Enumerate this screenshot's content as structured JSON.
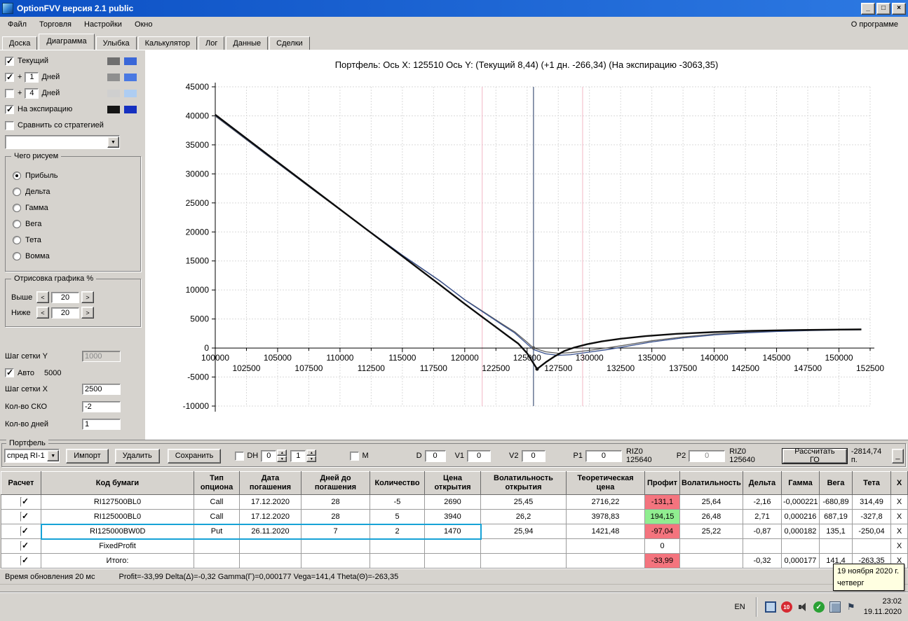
{
  "window": {
    "title": "OptionFVV версия 2.1 public",
    "controls": {
      "minimize": "_",
      "maximize": "□",
      "close": "×"
    }
  },
  "menu": {
    "items": [
      "Файл",
      "Торговля",
      "Настройки",
      "Окно"
    ],
    "about": "О программе"
  },
  "tabs": {
    "items": [
      "Доска",
      "Диаграмма",
      "Улыбка",
      "Калькулятор",
      "Лог",
      "Данные",
      "Сделки"
    ],
    "active": "Диаграмма"
  },
  "left_panel": {
    "current": {
      "checked": true,
      "label": "Текущий",
      "sw1": "#6f6f6f",
      "sw2": "#3a67d8"
    },
    "plus1": {
      "checked": true,
      "plus": "+",
      "value": "1",
      "label": "Дней",
      "sw1": "#8f8f8f",
      "sw2": "#4a79e2"
    },
    "plus4": {
      "checked": false,
      "plus": "+",
      "value": "4",
      "label": "Дней",
      "sw1": "#cfcfcf",
      "sw2": "#aecdf2"
    },
    "expiration": {
      "checked": true,
      "label": "На экспирацию",
      "sw1": "#151515",
      "sw2": "#1530c0"
    },
    "compare": {
      "checked": false,
      "label": "Сравнить со стратегией"
    },
    "strategy_select": {
      "value": ""
    },
    "draw_group": {
      "title": "Чего рисуем",
      "options": [
        "Прибыль",
        "Дельта",
        "Гамма",
        "Вега",
        "Тета",
        "Вомма"
      ],
      "selected": "Прибыль"
    },
    "render_group": {
      "title": "Отрисовка графика %",
      "above_label": "Выше",
      "above_value": "20",
      "below_label": "Ниже",
      "below_value": "20",
      "dec": "<",
      "inc": ">"
    },
    "grid_y": {
      "label": "Шаг сетки Y",
      "value": "1000"
    },
    "auto": {
      "checked": true,
      "label": "Авто",
      "value": "5000"
    },
    "grid_x": {
      "label": "Шаг сетки X",
      "value": "2500"
    },
    "sko": {
      "label": "Кол-во СКО",
      "value": "-2"
    },
    "days": {
      "label": "Кол-во дней",
      "value": "1"
    }
  },
  "chart_data": {
    "type": "line",
    "title": "Портфель:  Ось X: 125510 Ось Y:   (Текущий 8,44)   (+1 дн. -266,34)   (На экспирацию -3063,35)",
    "xlim": [
      100000,
      152500
    ],
    "ylim": [
      -10000,
      45000
    ],
    "grid": true,
    "legend_position": "left-panel-swatches",
    "y_ticks": [
      45000,
      40000,
      35000,
      30000,
      25000,
      20000,
      15000,
      10000,
      5000,
      0,
      -5000,
      -10000
    ],
    "x_ticks_major": [
      100000,
      105000,
      110000,
      115000,
      120000,
      125000,
      130000,
      135000,
      140000,
      145000,
      150000
    ],
    "x_ticks_minor": [
      102500,
      107500,
      112500,
      117500,
      122500,
      127500,
      132500,
      137500,
      142500,
      147500,
      152500
    ],
    "vlines": [
      {
        "x": 121400,
        "color": "#f2b6c6",
        "w": 1
      },
      {
        "x": 129450,
        "color": "#f2b6c6",
        "w": 1
      },
      {
        "x": 125510,
        "color": "#72809b",
        "w": 1.6
      }
    ],
    "markers": [
      {
        "x": 125800,
        "y": -3620,
        "color": "#111111"
      },
      {
        "x": 125510,
        "y": 8,
        "color": "#555555"
      }
    ],
    "series": [
      {
        "id": "current",
        "label": "Текущий",
        "color": "#5f5f5f",
        "width": 1.3,
        "points": [
          [
            100000,
            39950
          ],
          [
            104000,
            33450
          ],
          [
            108000,
            27000
          ],
          [
            112000,
            20650
          ],
          [
            115000,
            15950
          ],
          [
            118000,
            11550
          ],
          [
            120000,
            8350
          ],
          [
            121500,
            6250
          ],
          [
            123000,
            4150
          ],
          [
            124000,
            2800
          ],
          [
            125000,
            1000
          ],
          [
            125510,
            8
          ],
          [
            126500,
            -650
          ],
          [
            127500,
            -900
          ],
          [
            128500,
            -800
          ],
          [
            130000,
            -400
          ],
          [
            131500,
            50
          ],
          [
            133000,
            550
          ],
          [
            135000,
            1250
          ],
          [
            137500,
            1900
          ],
          [
            140000,
            2400
          ],
          [
            142500,
            2700
          ],
          [
            145000,
            2950
          ],
          [
            147500,
            3080
          ],
          [
            150000,
            3170
          ],
          [
            151800,
            3200
          ]
        ]
      },
      {
        "id": "plus-1-day",
        "label": "+1 день",
        "color": "#37508e",
        "width": 1.3,
        "points": [
          [
            100000,
            40050
          ],
          [
            104000,
            33500
          ],
          [
            108000,
            27050
          ],
          [
            112000,
            20700
          ],
          [
            115000,
            16000
          ],
          [
            118000,
            11600
          ],
          [
            120000,
            8300
          ],
          [
            121500,
            6150
          ],
          [
            123000,
            4000
          ],
          [
            124000,
            2600
          ],
          [
            125000,
            700
          ],
          [
            125510,
            -266
          ],
          [
            126500,
            -1000
          ],
          [
            127500,
            -1250
          ],
          [
            128500,
            -1150
          ],
          [
            130000,
            -700
          ],
          [
            131500,
            -250
          ],
          [
            133000,
            300
          ],
          [
            135000,
            1050
          ],
          [
            137500,
            1750
          ],
          [
            140000,
            2250
          ],
          [
            142500,
            2600
          ],
          [
            145000,
            2850
          ],
          [
            147500,
            3000
          ],
          [
            150000,
            3100
          ],
          [
            151800,
            3150
          ]
        ]
      },
      {
        "id": "expiration",
        "label": "На экспирацию",
        "color": "#0d0d0d",
        "width": 2.4,
        "points": [
          [
            100000,
            40200
          ],
          [
            104000,
            33650
          ],
          [
            108000,
            27150
          ],
          [
            112000,
            20650
          ],
          [
            115000,
            15800
          ],
          [
            118000,
            10900
          ],
          [
            120000,
            7600
          ],
          [
            121400,
            5350
          ],
          [
            122500,
            3600
          ],
          [
            123500,
            2000
          ],
          [
            124300,
            750
          ],
          [
            125000,
            -900
          ],
          [
            125800,
            -3620
          ],
          [
            126500,
            -2450
          ],
          [
            127200,
            -1450
          ],
          [
            128000,
            -500
          ],
          [
            128800,
            100
          ],
          [
            129800,
            650
          ],
          [
            131000,
            1150
          ],
          [
            132500,
            1600
          ],
          [
            134500,
            2050
          ],
          [
            137000,
            2450
          ],
          [
            140000,
            2750
          ],
          [
            143000,
            2950
          ],
          [
            146000,
            3080
          ],
          [
            149000,
            3160
          ],
          [
            151800,
            3210
          ]
        ]
      }
    ]
  },
  "portfolio": {
    "group_label": "Портфель",
    "preset": "спред RI-1",
    "import_label": "Импорт",
    "delete_label": "Удалить",
    "save_label": "Сохранить",
    "dh_label": "DH",
    "dh_spin1": "0",
    "dh_spin2": "1",
    "m_label": "M",
    "d_label": "D",
    "d_value": "0",
    "v1_label": "V1",
    "v1_value": "0",
    "v2_label": "V2",
    "v2_value": "0",
    "p1_label": "P1",
    "p1_value": "0",
    "p1_note": "RIZ0 125640",
    "p2_label": "P2",
    "p2_value": "0",
    "p2_note": "RIZ0 125640",
    "calc_label": "Рассчитать ГО",
    "go_result": "-2814,74 п.",
    "corner_label": "_"
  },
  "table": {
    "headers": [
      "Расчет",
      "Код бумаги",
      "Тип\nопциона",
      "Дата\nпогашения",
      "Дней до\nпогашения",
      "Количество",
      "Цена\nоткрытия",
      "Волатильность\nоткрытия",
      "Теоретическая\nцена",
      "Профит",
      "Волатильность",
      "Дельта",
      "Гамма",
      "Вега",
      "Тета",
      "X"
    ],
    "delete_label": "X",
    "highlight_color": "#16a2d6",
    "profit_neg_color": "#f4747e",
    "profit_pos_color": "#90ee90",
    "rows": [
      {
        "checked": true,
        "highlight": false,
        "profit": "neg",
        "cells": [
          "RI127500BL0",
          "Call",
          "17.12.2020",
          "28",
          "-5",
          "2690",
          "25,45",
          "2716,22",
          "-131,1",
          "25,64",
          "-2,16",
          "-0,000221",
          "-680,89",
          "314,49"
        ]
      },
      {
        "checked": true,
        "highlight": false,
        "profit": "pos",
        "cells": [
          "RI125000BL0",
          "Call",
          "17.12.2020",
          "28",
          "5",
          "3940",
          "26,2",
          "3978,83",
          "194,15",
          "26,48",
          "2,71",
          "0,000216",
          "687,19",
          "-327,8"
        ]
      },
      {
        "checked": true,
        "highlight": true,
        "profit": "neg",
        "cells": [
          "RI125000BW0D",
          "Put",
          "26.11.2020",
          "7",
          "2",
          "1470",
          "25,94",
          "1421,48",
          "-97,04",
          "25,22",
          "-0,87",
          "0,000182",
          "135,1",
          "-250,04"
        ]
      },
      {
        "checked": true,
        "highlight": false,
        "profit": "none",
        "cells": [
          "FixedProfit",
          "",
          "",
          "",
          "",
          "",
          "",
          "",
          "0",
          "",
          "",
          "",
          "",
          ""
        ]
      },
      {
        "checked": true,
        "highlight": false,
        "profit": "neg",
        "cells": [
          "Итого:",
          "",
          "",
          "",
          "",
          "",
          "",
          "",
          "-33,99",
          "",
          "-0,32",
          "0,000177",
          "141,4",
          "-263,35"
        ]
      }
    ]
  },
  "status_bar": {
    "update": "Время обновления 20 мс",
    "greeks": "Profit=-33,99 Delta(Δ)=-0,32 Gamma(Γ)=0,000177 Vega=141,4 Theta(Θ)=-263,35"
  },
  "tooltip": {
    "line1": "19 ноября 2020 г.",
    "line2": "четверг"
  },
  "taskbar": {
    "lang": "EN",
    "badge": "10",
    "time": "23:02",
    "date": "19.11.2020"
  }
}
